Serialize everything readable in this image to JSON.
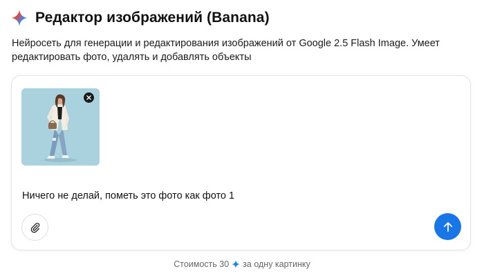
{
  "header": {
    "title": "Редактор изображений (Banana)",
    "logo_icon": "gemini-sparkle-icon"
  },
  "description": "Нейросеть для генерации и редактирования изображений от Google 2.5 Flash Image. Умеет редактировать фото, удалять и добавлять объекты",
  "composer": {
    "attachment": {
      "image_icon": "woman-photo",
      "remove_icon": "close-icon"
    },
    "prompt_text": "Ничего не делай, пометь это фото как фото 1",
    "attach_icon": "paperclip-icon",
    "send_icon": "arrow-up-icon"
  },
  "footer": {
    "cost_prefix": "Стоимость 30",
    "cost_suffix": "за одну картинку",
    "currency_icon": "sparkle-icon"
  },
  "colors": {
    "accent": "#1976e8",
    "photo_background": "#a9d2de"
  }
}
